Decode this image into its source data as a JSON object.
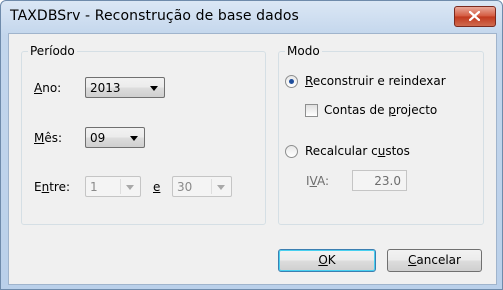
{
  "window": {
    "title": "TAXDBSrv - Reconstrução de base dados"
  },
  "periodo": {
    "title": "Período",
    "ano": {
      "label_u": "A",
      "label_rest": "no:",
      "value": "2013"
    },
    "mes": {
      "label_u": "M",
      "label_rest": "ês:",
      "value": "09"
    },
    "entre": {
      "label_pre": "E",
      "label_u": "n",
      "label_rest": "tre:",
      "from_value": "1",
      "sep_u": "e",
      "to_value": "30"
    }
  },
  "modo": {
    "title": "Modo",
    "reconstruir": {
      "label_u": "R",
      "label_rest": "econstruir e reindexar",
      "checked": true
    },
    "contas": {
      "label_pre": "Contas de ",
      "label_u": "p",
      "label_rest": "rojecto",
      "checked": false
    },
    "recalcular": {
      "label_pre": "Recalcular c",
      "label_u": "u",
      "label_rest": "stos",
      "checked": false
    },
    "iva": {
      "label_pre": "I",
      "label_u": "V",
      "label_rest": "A:",
      "value": "23.0"
    }
  },
  "buttons": {
    "ok": {
      "label_u": "O",
      "label_rest": "K"
    },
    "cancel": {
      "label_u": "C",
      "label_rest": "ancelar"
    }
  }
}
